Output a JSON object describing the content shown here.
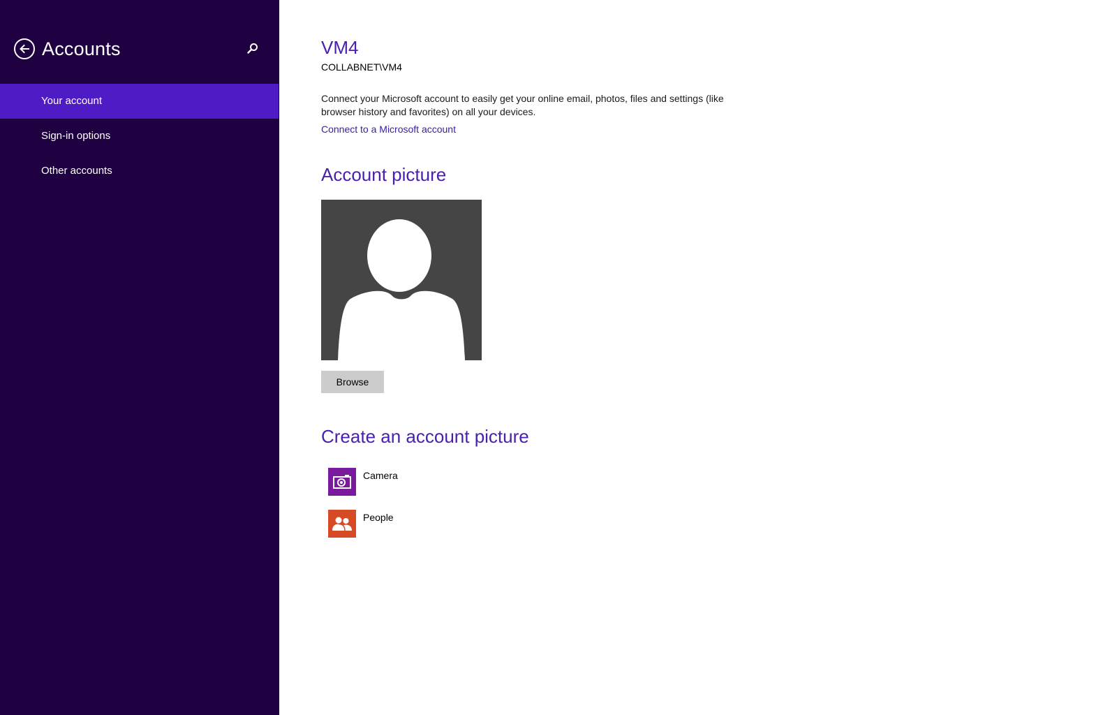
{
  "colors": {
    "sidebar_bg": "#1f0040",
    "nav_active_bg": "#4f1bc4",
    "accent_heading": "#4a1fb0",
    "link": "#3d1aa8",
    "avatar_bg": "#454545",
    "button_bg": "#cccccc",
    "camera_tile": "#7a1a9c",
    "people_tile": "#d64a25"
  },
  "sidebar": {
    "title": "Accounts",
    "back_icon": "back-arrow-circle-icon",
    "search_icon": "search-icon",
    "items": [
      {
        "label": "Your account",
        "active": true
      },
      {
        "label": "Sign-in options",
        "active": false
      },
      {
        "label": "Other accounts",
        "active": false
      }
    ]
  },
  "main": {
    "user_name": "VM4",
    "user_domain": "COLLABNET\\VM4",
    "connect_description": "Connect your Microsoft account to easily get your online email, photos, files and settings (like browser history and favorites) on all your devices.",
    "connect_link": "Connect to a Microsoft account",
    "account_picture_heading": "Account picture",
    "browse_button": "Browse",
    "create_heading": "Create an account picture",
    "apps": [
      {
        "label": "Camera",
        "icon": "camera-icon"
      },
      {
        "label": "People",
        "icon": "people-icon"
      }
    ]
  }
}
